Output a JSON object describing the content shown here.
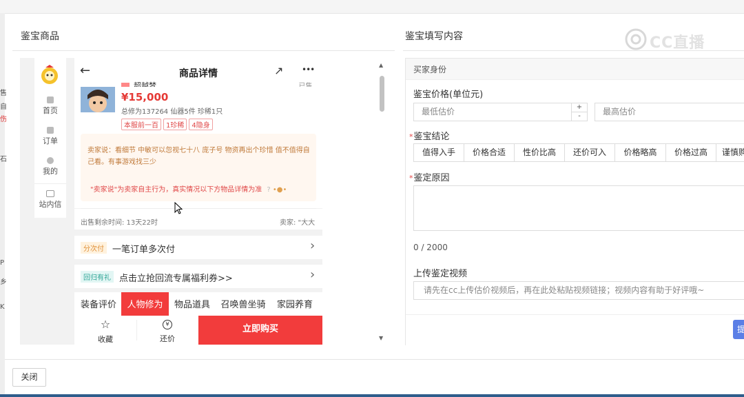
{
  "left_panel": {
    "title": "鉴宝商品"
  },
  "right_panel": {
    "title": "鉴宝填写内容"
  },
  "watermark": "CC直播",
  "edge_chars": [
    "售",
    "自",
    "伤",
    "石",
    "P",
    "乡",
    "K"
  ],
  "sidebar": {
    "items": [
      {
        "label": "首页",
        "icon": "home-icon"
      },
      {
        "label": "订单",
        "icon": "order-icon"
      },
      {
        "label": "我的",
        "icon": "user-icon"
      },
      {
        "label": "站内信",
        "icon": "mail-icon"
      }
    ]
  },
  "header": {
    "title": "商品详情",
    "back_icon": "←",
    "share_icon": "↗",
    "more_icon": "•••"
  },
  "product": {
    "name_partial": "超越梦",
    "right_partial": "...已售",
    "price": "¥15,000",
    "stats": "总修为137264  仙器5件  珍稀1只",
    "tags": [
      "本服前一百",
      "1珍稀",
      "4隐身"
    ]
  },
  "seller_note": {
    "prefix": "卖家说：",
    "text": "看细节 中敏可以忽视七十八 庞子号 物资再出个珍惜 值不值得自己看。有事游戏找三少",
    "disclaimer": "\"卖家说\"为卖家自主行为，真实情况以下方物品详情为准",
    "help_icon": "?"
  },
  "sale_info": {
    "remaining": "出售剩余时间: 13天22时",
    "seller": "卖家: \"大大"
  },
  "promos": [
    {
      "tag": "分次付",
      "text": "一笔订单多次付",
      "arrow": "›"
    },
    {
      "tag": "回归有礼",
      "text": "点击立抢回流专属福利券>>",
      "arrow": "›"
    }
  ],
  "tabs": [
    {
      "label": "装备评价",
      "active": false
    },
    {
      "label": "人物修为",
      "active": true
    },
    {
      "label": "物品道具",
      "active": false
    },
    {
      "label": "召唤兽坐骑",
      "active": false
    },
    {
      "label": "家园养育",
      "active": false
    }
  ],
  "bottom_bar": {
    "favorite": "收藏",
    "bargain": "还价",
    "buy": "立即购买"
  },
  "form": {
    "section_title": "买家身份",
    "price_label": "鉴宝价格(单位元)",
    "min_placeholder": "最低估价",
    "max_placeholder": "最高估价",
    "stepper_up": "+",
    "stepper_down": "-",
    "conclusion_label": "鉴宝结论",
    "conclusions": [
      "值得入手",
      "价格合适",
      "性价比高",
      "还价可入",
      "价格略高",
      "价格过高",
      "谨慎购买"
    ],
    "reason_label": "鉴定原因",
    "char_count": "0 / 2000",
    "video_label": "上传鉴定视频",
    "video_placeholder": "请先在cc上传估价视频后，再在此处粘贴视频链接；视频内容有助于好评哦~",
    "required_mark": "*",
    "submit_label": "提交"
  },
  "footer": {
    "close": "关闭"
  },
  "colors": {
    "accent_red": "#f23c3c",
    "price_red": "#e53935",
    "link_blue": "#5b7fe6"
  }
}
